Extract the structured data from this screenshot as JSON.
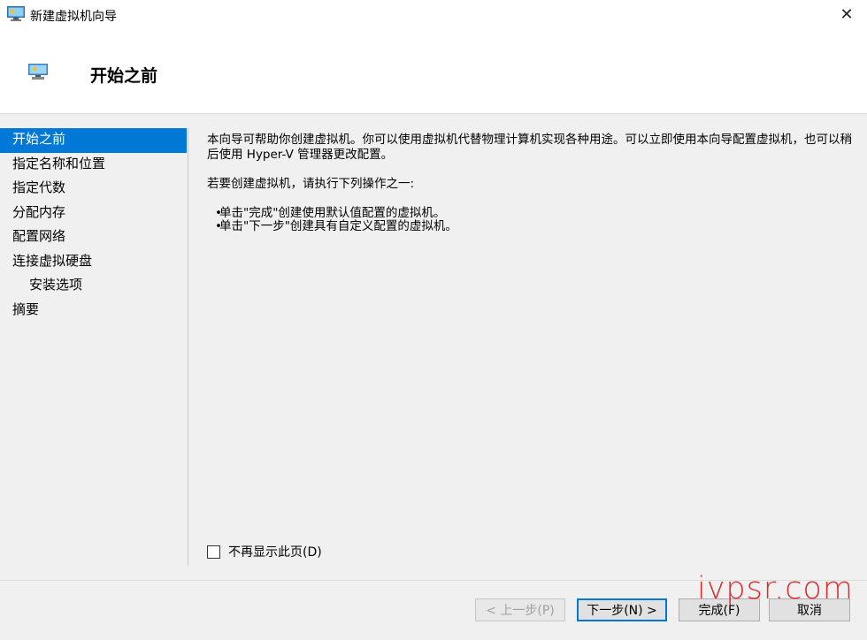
{
  "window": {
    "title": "新建虚拟机向导",
    "close_label": "✕"
  },
  "header": {
    "title": "开始之前"
  },
  "sidebar": {
    "items": [
      {
        "label": "开始之前",
        "active": true
      },
      {
        "label": "指定名称和位置"
      },
      {
        "label": "指定代数"
      },
      {
        "label": "分配内存"
      },
      {
        "label": "配置网络"
      },
      {
        "label": "连接虚拟硬盘"
      },
      {
        "label": "安装选项",
        "indent": true
      },
      {
        "label": "摘要"
      }
    ]
  },
  "content": {
    "paragraph1": "本向导可帮助你创建虚拟机。你可以使用虚拟机代替物理计算机实现各种用途。可以立即使用本向导配置虚拟机，也可以稍后使用 Hyper-V 管理器更改配置。",
    "paragraph2": "若要创建虚拟机，请执行下列操作之一:",
    "bullets": [
      "单击\"完成\"创建使用默认值配置的虚拟机。",
      "单击\"下一步\"创建具有自定义配置的虚拟机。"
    ]
  },
  "checkbox": {
    "label": "不再显示此页(D)",
    "checked": false
  },
  "buttons": {
    "prev": "< 上一步(P)",
    "next": "下一步(N) >",
    "finish": "完成(F)",
    "cancel": "取消"
  },
  "watermark": "ivpsr.com",
  "colors": {
    "accent": "#0078d7",
    "watermark": "#e02a2a"
  }
}
